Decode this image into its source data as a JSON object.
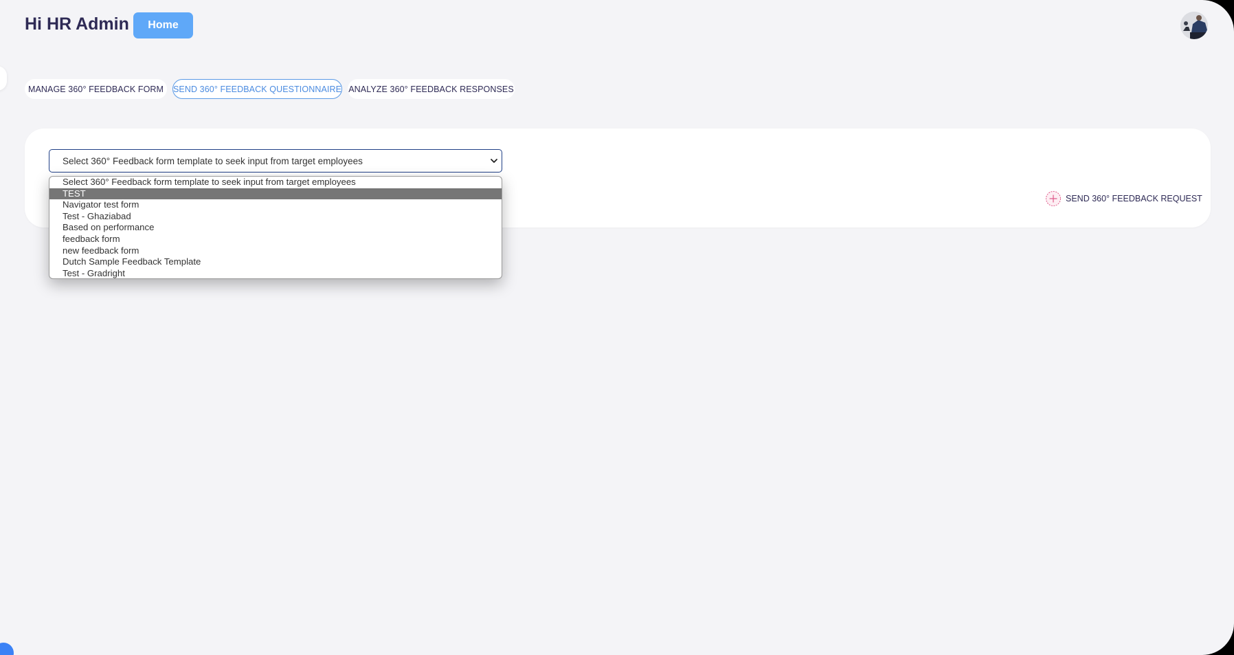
{
  "header": {
    "greeting": "Hi HR Admin",
    "home_label": "Home"
  },
  "tabs": [
    {
      "label": "MANAGE 360° FEEDBACK FORM",
      "active": false
    },
    {
      "label": "SEND 360° FEEDBACK QUESTIONNAIRE",
      "active": true
    },
    {
      "label": "ANALYZE 360° FEEDBACK RESPONSES",
      "active": false
    }
  ],
  "form": {
    "select_value": "Select 360° Feedback form template to seek input from target employees",
    "options": [
      "Select 360° Feedback form template to seek input from target employees",
      "TEST",
      "Navigator test form",
      "Test - Ghaziabad",
      "Based on performance",
      "feedback form",
      "new feedback form",
      "Dutch Sample Feedback Template",
      "Test - Gradright"
    ],
    "highlighted_option": "TEST",
    "send_label": "SEND 360° FEEDBACK REQUEST"
  },
  "colors": {
    "accent": "#5fa8f8",
    "title": "#2e2a55",
    "active_tab": "#4b8be0",
    "send_icon": "#e05a8a"
  },
  "icons": {
    "select_arrow": "chevron-down-icon",
    "send": "plus-circle-icon",
    "avatar": "user-avatar"
  }
}
